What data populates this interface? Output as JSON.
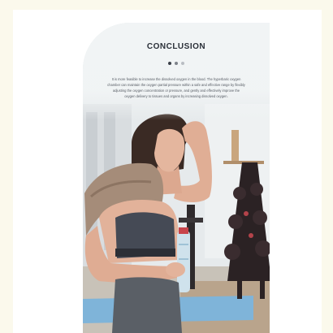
{
  "slide": {
    "title": "CONCLUSION",
    "pagination": {
      "total": 3,
      "active_index": 0
    },
    "body": "It is more feasible to increase the dissolved oxygen in the blood. The hyperbaric oxygen chamber can maintain the oxygen partial pressure within a safe and effective range by flexibly adjusting the oxygen concentration or pressure, and gently and effectively improve the oxygen delivery to tissues and organs by increasing dissolved oxygen."
  },
  "colors": {
    "page_background": "#fbf9ec",
    "slide_background": "#ffffff",
    "title_color": "#2a2f38",
    "body_color": "#555b63"
  },
  "image": {
    "subject": "woman with towel holding water bottle in gym"
  }
}
